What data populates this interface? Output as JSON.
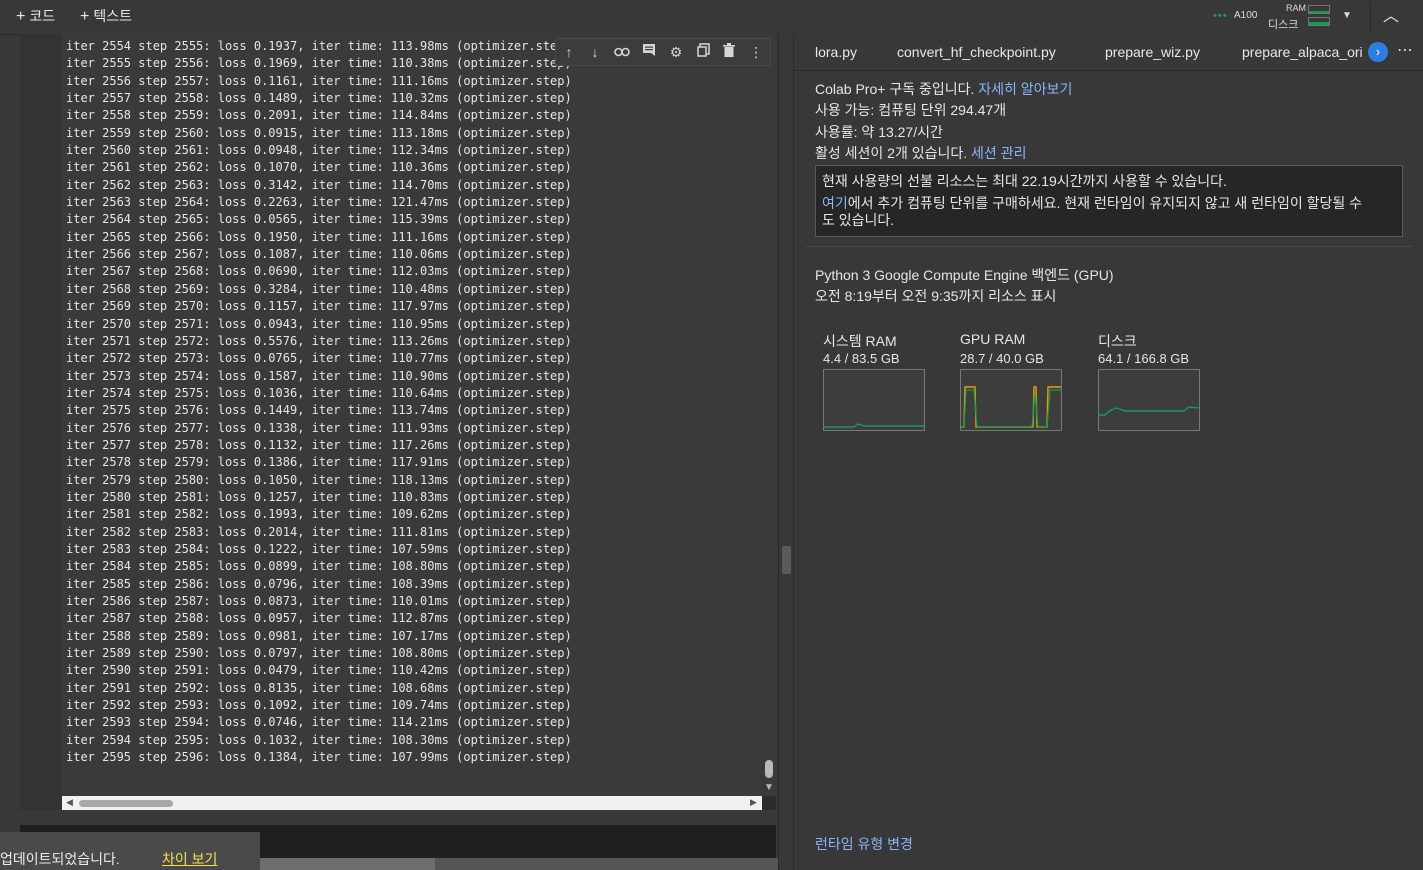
{
  "topbar": {
    "add_code": "코드",
    "add_text": "텍스트",
    "plus": "+"
  },
  "resources": {
    "gpu": "A100",
    "ram_label": "RAM",
    "disk_label": "디스크"
  },
  "log_lines": [
    "iter 2554 step 2555: loss 0.1937, iter time: 113.98ms (optimizer.step)",
    "iter 2555 step 2556: loss 0.1969, iter time: 110.38ms (optimizer.step)",
    "iter 2556 step 2557: loss 0.1161, iter time: 111.16ms (optimizer.step)",
    "iter 2557 step 2558: loss 0.1489, iter time: 110.32ms (optimizer.step)",
    "iter 2558 step 2559: loss 0.2091, iter time: 114.84ms (optimizer.step)",
    "iter 2559 step 2560: loss 0.0915, iter time: 113.18ms (optimizer.step)",
    "iter 2560 step 2561: loss 0.0948, iter time: 112.34ms (optimizer.step)",
    "iter 2561 step 2562: loss 0.1070, iter time: 110.36ms (optimizer.step)",
    "iter 2562 step 2563: loss 0.3142, iter time: 114.70ms (optimizer.step)",
    "iter 2563 step 2564: loss 0.2263, iter time: 121.47ms (optimizer.step)",
    "iter 2564 step 2565: loss 0.0565, iter time: 115.39ms (optimizer.step)",
    "iter 2565 step 2566: loss 0.1950, iter time: 111.16ms (optimizer.step)",
    "iter 2566 step 2567: loss 0.1087, iter time: 110.06ms (optimizer.step)",
    "iter 2567 step 2568: loss 0.0690, iter time: 112.03ms (optimizer.step)",
    "iter 2568 step 2569: loss 0.3284, iter time: 110.48ms (optimizer.step)",
    "iter 2569 step 2570: loss 0.1157, iter time: 117.97ms (optimizer.step)",
    "iter 2570 step 2571: loss 0.0943, iter time: 110.95ms (optimizer.step)",
    "iter 2571 step 2572: loss 0.5576, iter time: 113.26ms (optimizer.step)",
    "iter 2572 step 2573: loss 0.0765, iter time: 110.77ms (optimizer.step)",
    "iter 2573 step 2574: loss 0.1587, iter time: 110.90ms (optimizer.step)",
    "iter 2574 step 2575: loss 0.1036, iter time: 110.64ms (optimizer.step)",
    "iter 2575 step 2576: loss 0.1449, iter time: 113.74ms (optimizer.step)",
    "iter 2576 step 2577: loss 0.1338, iter time: 111.93ms (optimizer.step)",
    "iter 2577 step 2578: loss 0.1132, iter time: 117.26ms (optimizer.step)",
    "iter 2578 step 2579: loss 0.1386, iter time: 117.91ms (optimizer.step)",
    "iter 2579 step 2580: loss 0.1050, iter time: 118.13ms (optimizer.step)",
    "iter 2580 step 2581: loss 0.1257, iter time: 110.83ms (optimizer.step)",
    "iter 2581 step 2582: loss 0.1993, iter time: 109.62ms (optimizer.step)",
    "iter 2582 step 2583: loss 0.2014, iter time: 111.81ms (optimizer.step)",
    "iter 2583 step 2584: loss 0.1222, iter time: 107.59ms (optimizer.step)",
    "iter 2584 step 2585: loss 0.0899, iter time: 108.80ms (optimizer.step)",
    "iter 2585 step 2586: loss 0.0796, iter time: 108.39ms (optimizer.step)",
    "iter 2586 step 2587: loss 0.0873, iter time: 110.01ms (optimizer.step)",
    "iter 2587 step 2588: loss 0.0957, iter time: 112.87ms (optimizer.step)",
    "iter 2588 step 2589: loss 0.0981, iter time: 107.17ms (optimizer.step)",
    "iter 2589 step 2590: loss 0.0797, iter time: 108.80ms (optimizer.step)",
    "iter 2590 step 2591: loss 0.0479, iter time: 110.42ms (optimizer.step)",
    "iter 2591 step 2592: loss 0.8135, iter time: 108.68ms (optimizer.step)",
    "iter 2592 step 2593: loss 0.1092, iter time: 109.74ms (optimizer.step)",
    "iter 2593 step 2594: loss 0.0746, iter time: 114.21ms (optimizer.step)",
    "iter 2594 step 2595: loss 0.1032, iter time: 108.30ms (optimizer.step)",
    "iter 2595 step 2596: loss 0.1384, iter time: 107.99ms (optimizer.step)"
  ],
  "toast": {
    "message": "업데이트되었습니다.",
    "action": "차이 보기"
  },
  "tabs": [
    "lora.py",
    "convert_hf_checkpoint.py",
    "prepare_wiz.py",
    "prepare_alpaca_ori"
  ],
  "info": {
    "subscription": "Colab Pro+ 구독 중입니다.",
    "learn_more": "자세히 알아보기",
    "available": "사용 가능: 컴퓨팅 단위 294.47개",
    "usage_rate": "사용률: 약 13.27/시간",
    "sessions": "활성 세션이 2개 있습니다.",
    "manage_sessions": "세션 관리",
    "notice_line1": "현재 사용량의 선불 리소스는 최대 22.19시간까지 사용할 수 있습니다.",
    "notice_link": "여기",
    "notice_line2": "에서 추가 컴퓨팅 단위를 구매하세요. 현재 런타임이 유지되지 않고 새 런타임이 할당될 수",
    "notice_line3": "도 있습니다.",
    "backend": "Python 3 Google Compute Engine 백엔드 (GPU)",
    "period": "오전 8:19부터 오전 9:35까지 리소스 표시"
  },
  "metrics": [
    {
      "name": "시스템 RAM",
      "value": "4.4 / 83.5 GB"
    },
    {
      "name": "GPU RAM",
      "value": "28.7 / 40.0 GB"
    },
    {
      "name": "디스크",
      "value": "64.1 / 166.8 GB"
    }
  ],
  "runtime_change": "런타임 유형 변경",
  "colors": {
    "accent_blue": "#8ab4f8",
    "green_line": "#0f9d58",
    "orange_line": "#f29900",
    "link_yellow": "#f4e04d"
  }
}
